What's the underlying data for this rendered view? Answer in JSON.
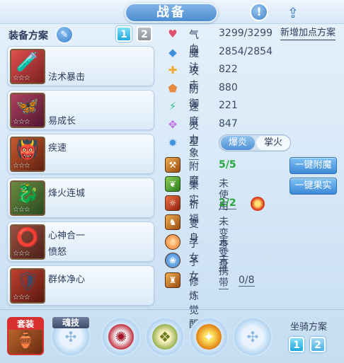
{
  "title": "战备",
  "info_label": "!",
  "share_label": "⇪",
  "equip_plan": {
    "label": "装备方案",
    "buttons": [
      "1",
      "2"
    ]
  },
  "new_plan_link": "新增加点方案",
  "slots": [
    {
      "name": "法术暴击",
      "name2": "",
      "icon": "🧪",
      "stars": "☆☆☆"
    },
    {
      "name": "易成长",
      "name2": "",
      "icon": "🦋",
      "stars": "☆☆☆"
    },
    {
      "name": "疾速",
      "name2": "",
      "icon": "👹",
      "stars": "☆☆☆"
    },
    {
      "name": "烽火连城",
      "name2": "",
      "icon": "🐉",
      "stars": "☆☆☆"
    },
    {
      "name": "心神合一",
      "name2": "愤怒",
      "icon": "⭕",
      "stars": "☆☆☆"
    },
    {
      "name": "群体净心",
      "name2": "",
      "icon": "🛡",
      "stars": "☆☆☆"
    }
  ],
  "attributes": [
    {
      "key": "气血",
      "value": "3299/3299",
      "icon": "♥",
      "color": "#e0506a"
    },
    {
      "key": "魔法",
      "value": "2854/2854",
      "icon": "◆",
      "color": "#3d8fe0"
    },
    {
      "key": "攻击",
      "value": "822",
      "icon": "✚",
      "color": "#f0a830"
    },
    {
      "key": "防御",
      "value": "880",
      "icon": "⬟",
      "color": "#e88a40"
    },
    {
      "key": "速度",
      "value": "221",
      "icon": "⚡",
      "color": "#2fbf8a"
    },
    {
      "key": "灵力",
      "value": "847",
      "icon": "✥",
      "color": "#c070e0"
    }
  ],
  "xingxiang": {
    "key": "星象",
    "icon": "✹",
    "options": [
      "爆炎",
      "掌火"
    ]
  },
  "actions": [
    {
      "key": "附魔",
      "value": "5/5",
      "icon": "⚒",
      "green": true
    },
    {
      "key": "果实",
      "value": "未使用",
      "icon": "❦",
      "green": false
    },
    {
      "key": "祈福",
      "value": "2/2",
      "icon": "☼",
      "green": true
    },
    {
      "key": "变身",
      "value": "未变身",
      "icon": "♞",
      "green": false
    },
    {
      "key": "子女",
      "value": "未变身",
      "icon": "☃",
      "green": false
    },
    {
      "key": "子女",
      "value": "未携带",
      "icon": "❀",
      "green": false
    },
    {
      "key": "修炼觉醒",
      "value": "0/8",
      "icon": "♜",
      "green": false
    }
  ],
  "buttons": {
    "enchant": "一键附魔",
    "fruit": "一键果实"
  },
  "bottom": {
    "taozhuang": "套装",
    "hunji": "魂技",
    "mount_label": "坐骑方案",
    "mount_buttons": [
      "1",
      "2"
    ]
  },
  "colors": {
    "accent": "#4d8ed1",
    "active": "#1fa7df",
    "green": "#26a83a"
  }
}
